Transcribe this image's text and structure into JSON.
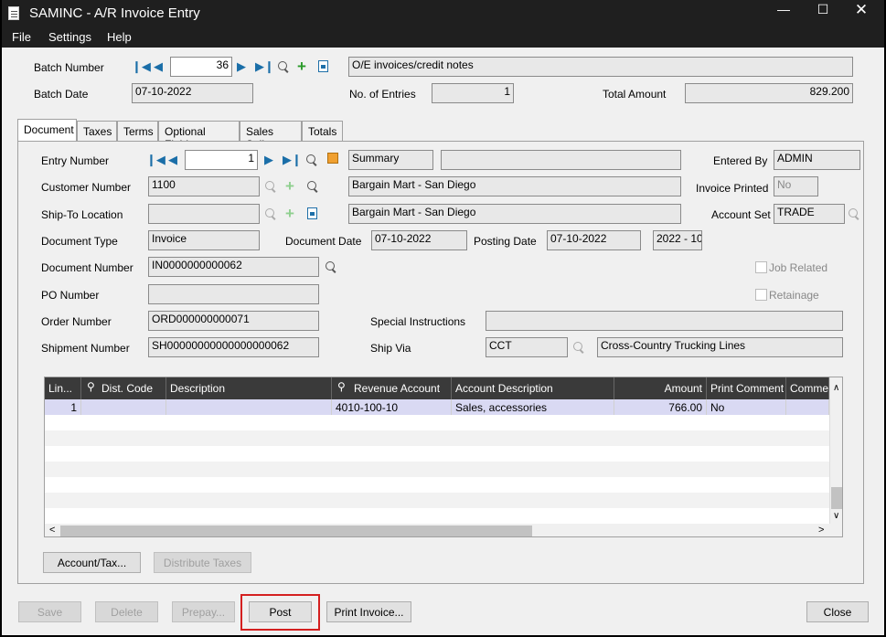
{
  "window": {
    "title": "SAMINC - A/R Invoice Entry"
  },
  "menu": {
    "file": "File",
    "settings": "Settings",
    "help": "Help"
  },
  "header": {
    "batch_number_label": "Batch Number",
    "batch_number": "36",
    "batch_description": "O/E invoices/credit notes",
    "batch_date_label": "Batch Date",
    "batch_date": "07-10-2022",
    "entries_label": "No. of Entries",
    "entries": "1",
    "total_amount_label": "Total Amount",
    "total_amount": "829.200"
  },
  "tabs": [
    "Document",
    "Taxes",
    "Terms",
    "Optional Fields",
    "Sales Split",
    "Totals"
  ],
  "document": {
    "entry_number_label": "Entry Number",
    "entry_number": "1",
    "entry_description": "Summary",
    "entered_by_label": "Entered By",
    "entered_by": "ADMIN",
    "customer_number_label": "Customer Number",
    "customer_number": "1100",
    "customer_name": "Bargain Mart - San Diego",
    "invoice_printed_label": "Invoice Printed",
    "invoice_printed": "No",
    "ship_to_label": "Ship-To Location",
    "ship_to": "",
    "ship_to_name": "Bargain Mart - San Diego",
    "account_set_label": "Account Set",
    "account_set": "TRADE",
    "document_type_label": "Document Type",
    "document_type": "Invoice",
    "document_date_label": "Document Date",
    "document_date": "07-10-2022",
    "posting_date_label": "Posting Date",
    "posting_date": "07-10-2022",
    "fiscal_period": "2022 - 10",
    "document_number_label": "Document Number",
    "document_number": "IN0000000000062",
    "job_related_label": "Job Related",
    "po_number_label": "PO Number",
    "po_number": "",
    "retainage_label": "Retainage",
    "order_number_label": "Order Number",
    "order_number": "ORD000000000071",
    "special_instructions_label": "Special Instructions",
    "special_instructions": "",
    "shipment_number_label": "Shipment Number",
    "shipment_number": "SH00000000000000000062",
    "ship_via_label": "Ship Via",
    "ship_via": "CCT",
    "ship_via_name": "Cross-Country Trucking Lines"
  },
  "grid": {
    "columns": [
      "Lin...",
      "Dist. Code",
      "Description",
      "Revenue Account",
      "Account Description",
      "Amount",
      "Print Comment",
      "Commen"
    ],
    "rows": [
      {
        "line": "1",
        "dist_code": "",
        "description": "",
        "revenue_account": "4010-100-10",
        "account_description": "Sales, accessories",
        "amount": "766.00",
        "print_comment": "No",
        "comment": ""
      }
    ]
  },
  "buttons": {
    "account_tax": "Account/Tax...",
    "distribute_taxes": "Distribute Taxes",
    "save": "Save",
    "delete": "Delete",
    "prepay": "Prepay...",
    "post": "Post",
    "print_invoice": "Print Invoice...",
    "close": "Close"
  },
  "colors": {
    "titlebar": "#1f1f1f",
    "grid_header": "#3a3a3a",
    "selected_row": "#d9d9f3",
    "highlight": "#d42020"
  }
}
